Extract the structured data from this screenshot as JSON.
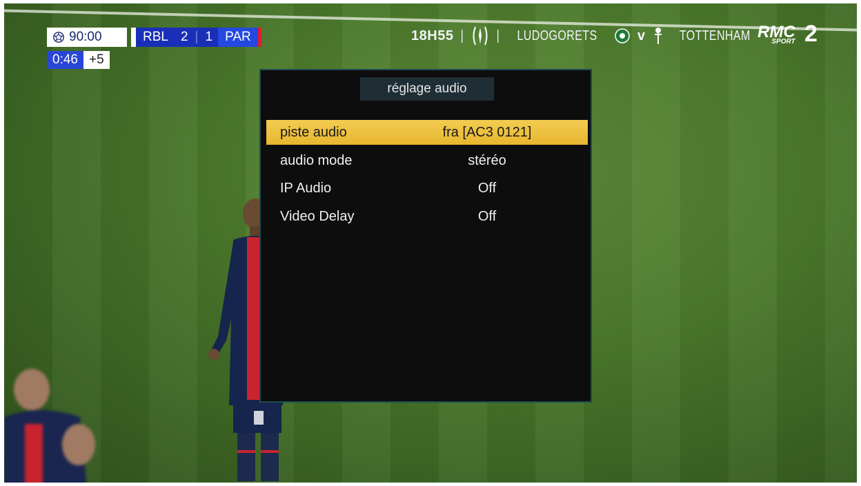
{
  "scoreboard": {
    "clock": "90:00",
    "home_team": "RBL",
    "home_score": "2",
    "away_score": "1",
    "away_team": "PAR",
    "added_time_clock": "0:46",
    "added_time": "+5"
  },
  "promo": {
    "time": "18H55",
    "team_a": "LUDOGORETS",
    "versus": "v",
    "team_b": "TOTTENHAM",
    "channel": "RMC",
    "channel_sub": "SPORT",
    "channel_number": "2"
  },
  "menu": {
    "title": "réglage audio",
    "items": [
      {
        "label": "piste audio",
        "value": "fra [AC3 0121]",
        "selected": true
      },
      {
        "label": "audio mode",
        "value": "stéréo",
        "selected": false
      },
      {
        "label": "IP Audio",
        "value": "Off",
        "selected": false
      },
      {
        "label": "Video Delay",
        "value": "Off",
        "selected": false
      }
    ]
  },
  "colors": {
    "highlight": "#f0c242",
    "menu_bg": "#0d0d0d",
    "menu_border": "#1e4b52",
    "scoreboard_blue": "#1a2fb8"
  }
}
